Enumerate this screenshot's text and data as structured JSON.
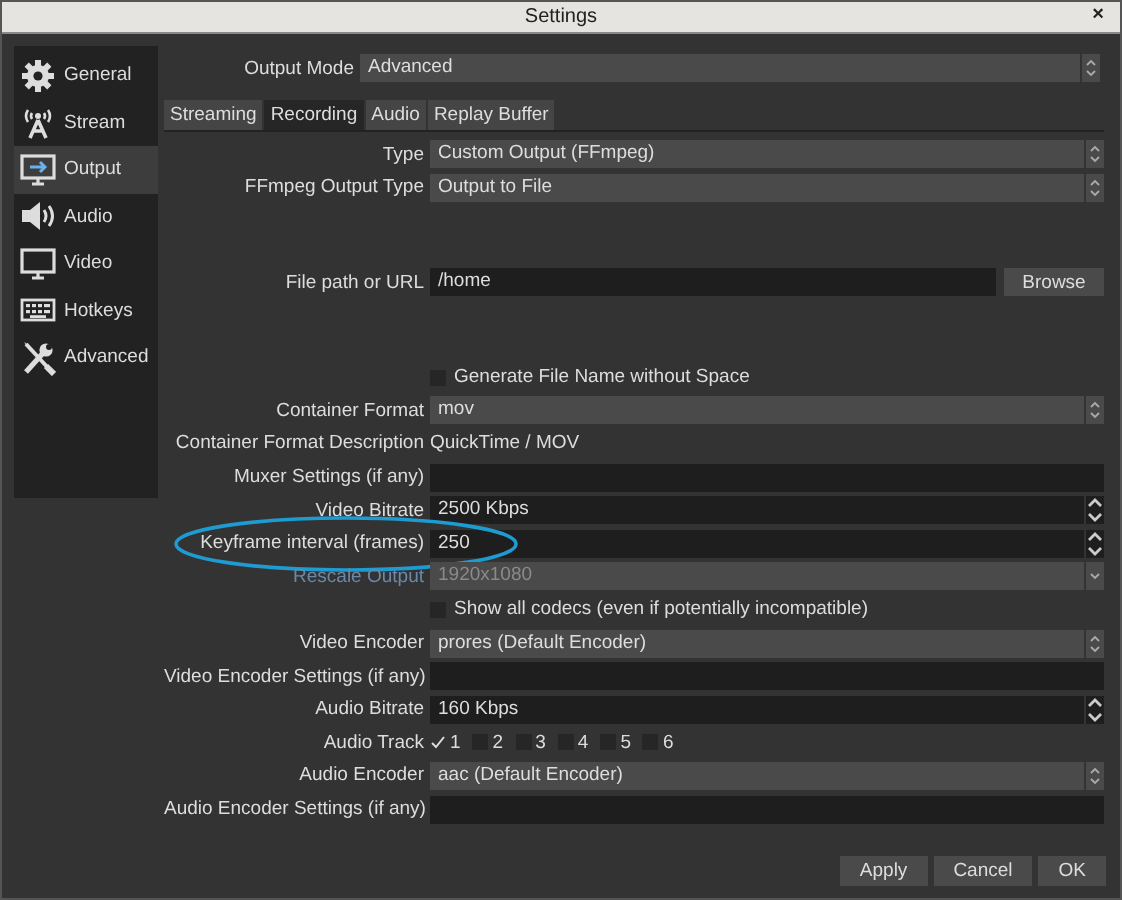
{
  "window": {
    "title": "Settings",
    "close": "×"
  },
  "sidebar": {
    "items": [
      {
        "label": "General",
        "selected": false
      },
      {
        "label": "Stream",
        "selected": false
      },
      {
        "label": "Output",
        "selected": true
      },
      {
        "label": "Audio",
        "selected": false
      },
      {
        "label": "Video",
        "selected": false
      },
      {
        "label": "Hotkeys",
        "selected": false
      },
      {
        "label": "Advanced",
        "selected": false
      }
    ]
  },
  "output_mode": {
    "label": "Output Mode",
    "value": "Advanced"
  },
  "tabs": [
    {
      "label": "Streaming",
      "selected": false
    },
    {
      "label": "Recording",
      "selected": true
    },
    {
      "label": "Audio",
      "selected": false
    },
    {
      "label": "Replay Buffer",
      "selected": false
    }
  ],
  "fields": [
    {
      "kind": "combo",
      "label": "Type",
      "value": "Custom Output (FFmpeg)",
      "disabled": false,
      "highlighted": false
    },
    {
      "kind": "combo",
      "label": "FFmpeg Output Type",
      "value": "Output to File",
      "disabled": false,
      "highlighted": false
    },
    {
      "kind": "path",
      "label": "File path or URL",
      "value": "/home",
      "button": "Browse",
      "disabled": false,
      "highlighted": false
    },
    {
      "kind": "checkbox",
      "label": "Generate File Name without Space",
      "checked": false,
      "disabled": false,
      "highlighted": false
    },
    {
      "kind": "combo",
      "label": "Container Format",
      "value": "mov",
      "disabled": false,
      "highlighted": false
    },
    {
      "kind": "info",
      "label": "Container Format Description",
      "value": "QuickTime / MOV",
      "disabled": false,
      "highlighted": false
    },
    {
      "kind": "text",
      "label": "Muxer Settings (if any)",
      "disabled": false,
      "highlighted": false
    },
    {
      "kind": "spin",
      "label": "Video Bitrate",
      "value": "2500 Kbps",
      "disabled": false,
      "highlighted": false
    },
    {
      "kind": "spin",
      "label": "Keyframe interval (frames)",
      "value": "250",
      "disabled": false,
      "highlighted": true
    },
    {
      "kind": "dropdown",
      "label": "Rescale Output",
      "value": "1920x1080",
      "disabled": true,
      "highlighted": false
    },
    {
      "kind": "checkbox",
      "label": "Show all codecs (even if potentially incompatible)",
      "checked": false,
      "disabled": false,
      "highlighted": false
    },
    {
      "kind": "combo",
      "label": "Video Encoder",
      "value": "prores (Default Encoder)",
      "disabled": false,
      "highlighted": false
    },
    {
      "kind": "text",
      "label": "Video Encoder Settings (if any)",
      "disabled": false,
      "highlighted": false
    },
    {
      "kind": "spin",
      "label": "Audio Bitrate",
      "value": "160 Kbps",
      "disabled": false,
      "highlighted": false
    },
    {
      "kind": "tracks",
      "label": "Audio Track",
      "disabled": false,
      "highlighted": false,
      "tracks": [
        {
          "label": "1",
          "checked": true
        },
        {
          "label": "2",
          "checked": false
        },
        {
          "label": "3",
          "checked": false
        },
        {
          "label": "4",
          "checked": false
        },
        {
          "label": "5",
          "checked": false
        },
        {
          "label": "6",
          "checked": false
        }
      ]
    },
    {
      "kind": "combo",
      "label": "Audio Encoder",
      "value": "aac (Default Encoder)",
      "disabled": false,
      "highlighted": false
    },
    {
      "kind": "text",
      "label": "Audio Encoder Settings (if any)",
      "disabled": false,
      "highlighted": false
    }
  ],
  "buttons": [
    "Apply",
    "Cancel",
    "OK"
  ]
}
